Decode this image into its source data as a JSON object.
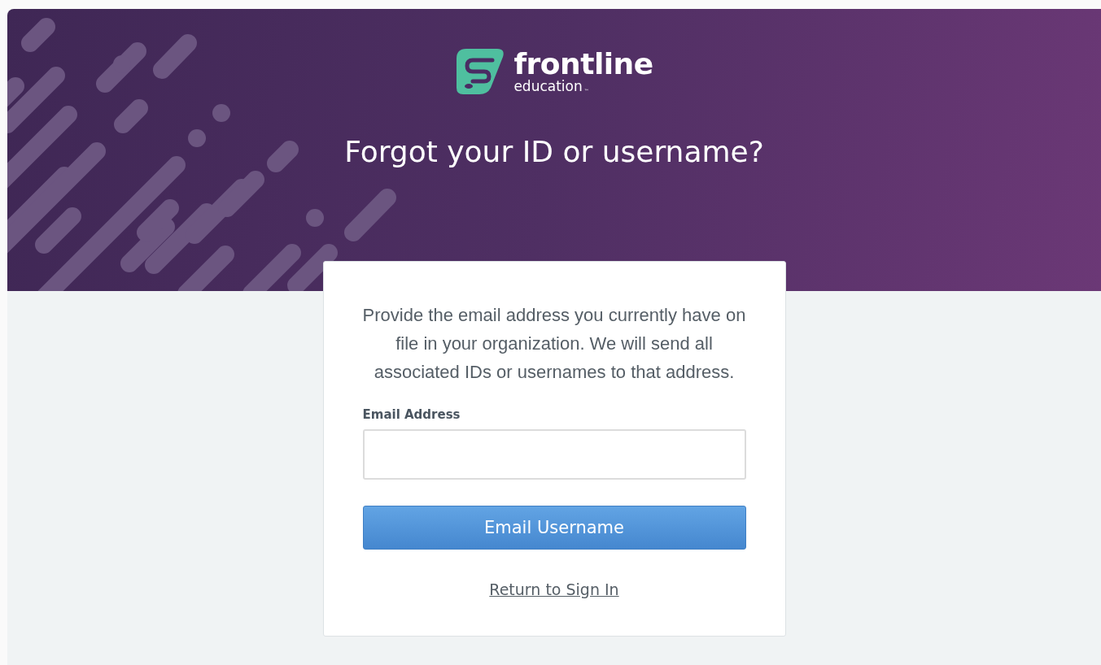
{
  "logo": {
    "wordmark": "frontline",
    "tagline": "education",
    "trademark": "™"
  },
  "title": "Forgot your ID or username?",
  "card": {
    "instructions": "Provide the email address you currently have on file in your organization.  We will send all associated IDs or usernames to that address.",
    "email_field": {
      "label": "Email Address"
    },
    "submit_button": "Email Username",
    "return_link": "Return to Sign In"
  }
}
